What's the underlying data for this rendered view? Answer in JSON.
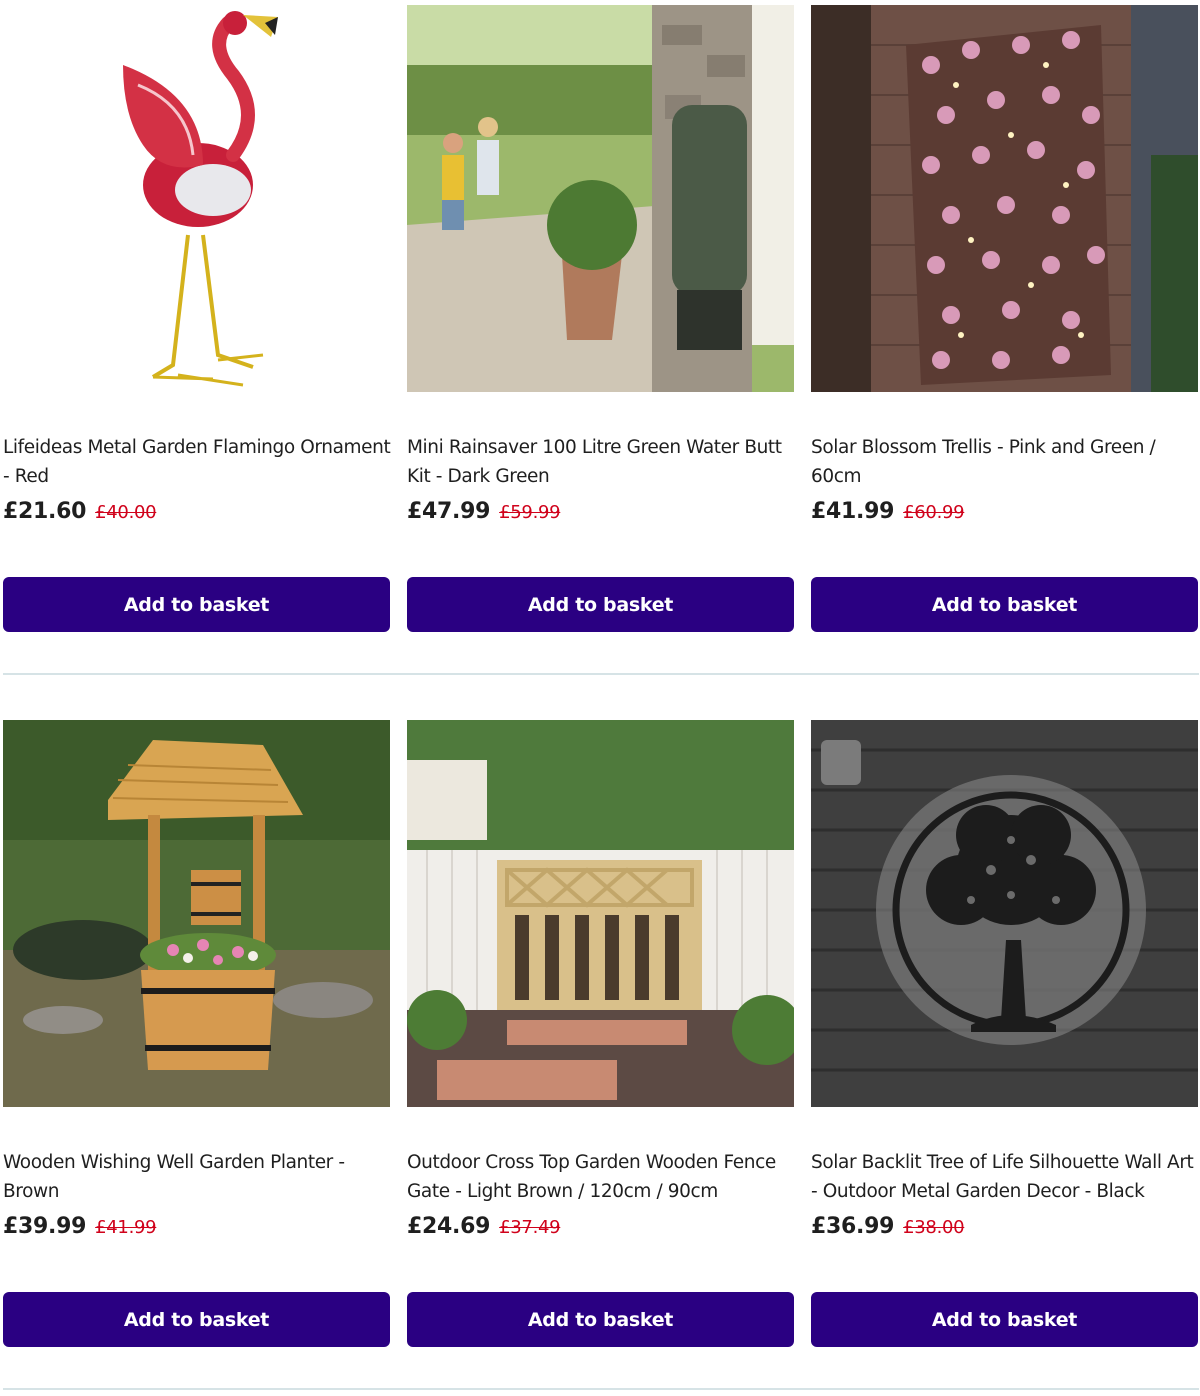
{
  "products": [
    {
      "title": "Lifeideas Metal Garden Flamingo Ornament - Red",
      "price": "£21.60",
      "was_price": "£40.00",
      "button_label": "Add to basket",
      "image": "flamingo-ornament"
    },
    {
      "title": "Mini Rainsaver 100 Litre Green Water Butt Kit - Dark Green",
      "price": "£47.99",
      "was_price": "£59.99",
      "button_label": "Add to basket",
      "image": "water-butt"
    },
    {
      "title": "Solar Blossom Trellis - Pink and Green / 60cm",
      "price": "£41.99",
      "was_price": "£60.99",
      "button_label": "Add to basket",
      "image": "blossom-trellis"
    },
    {
      "title": "Wooden Wishing Well Garden Planter - Brown",
      "price": "£39.99",
      "was_price": "£41.99",
      "button_label": "Add to basket",
      "image": "wishing-well"
    },
    {
      "title": "Outdoor Cross Top Garden Wooden Fence Gate - Light Brown / 120cm / 90cm",
      "price": "£24.69",
      "was_price": "£37.49",
      "button_label": "Add to basket",
      "image": "fence-gate"
    },
    {
      "title": "Solar Backlit Tree of Life Silhouette Wall Art - Outdoor Metal Garden Decor - Black",
      "price": "£36.99",
      "was_price": "£38.00",
      "button_label": "Add to basket",
      "image": "tree-of-life"
    }
  ],
  "colors": {
    "button_bg": "#2a0082",
    "button_text": "#ffffff",
    "was_price": "#d0021b",
    "divider": "#d6e3e6"
  }
}
